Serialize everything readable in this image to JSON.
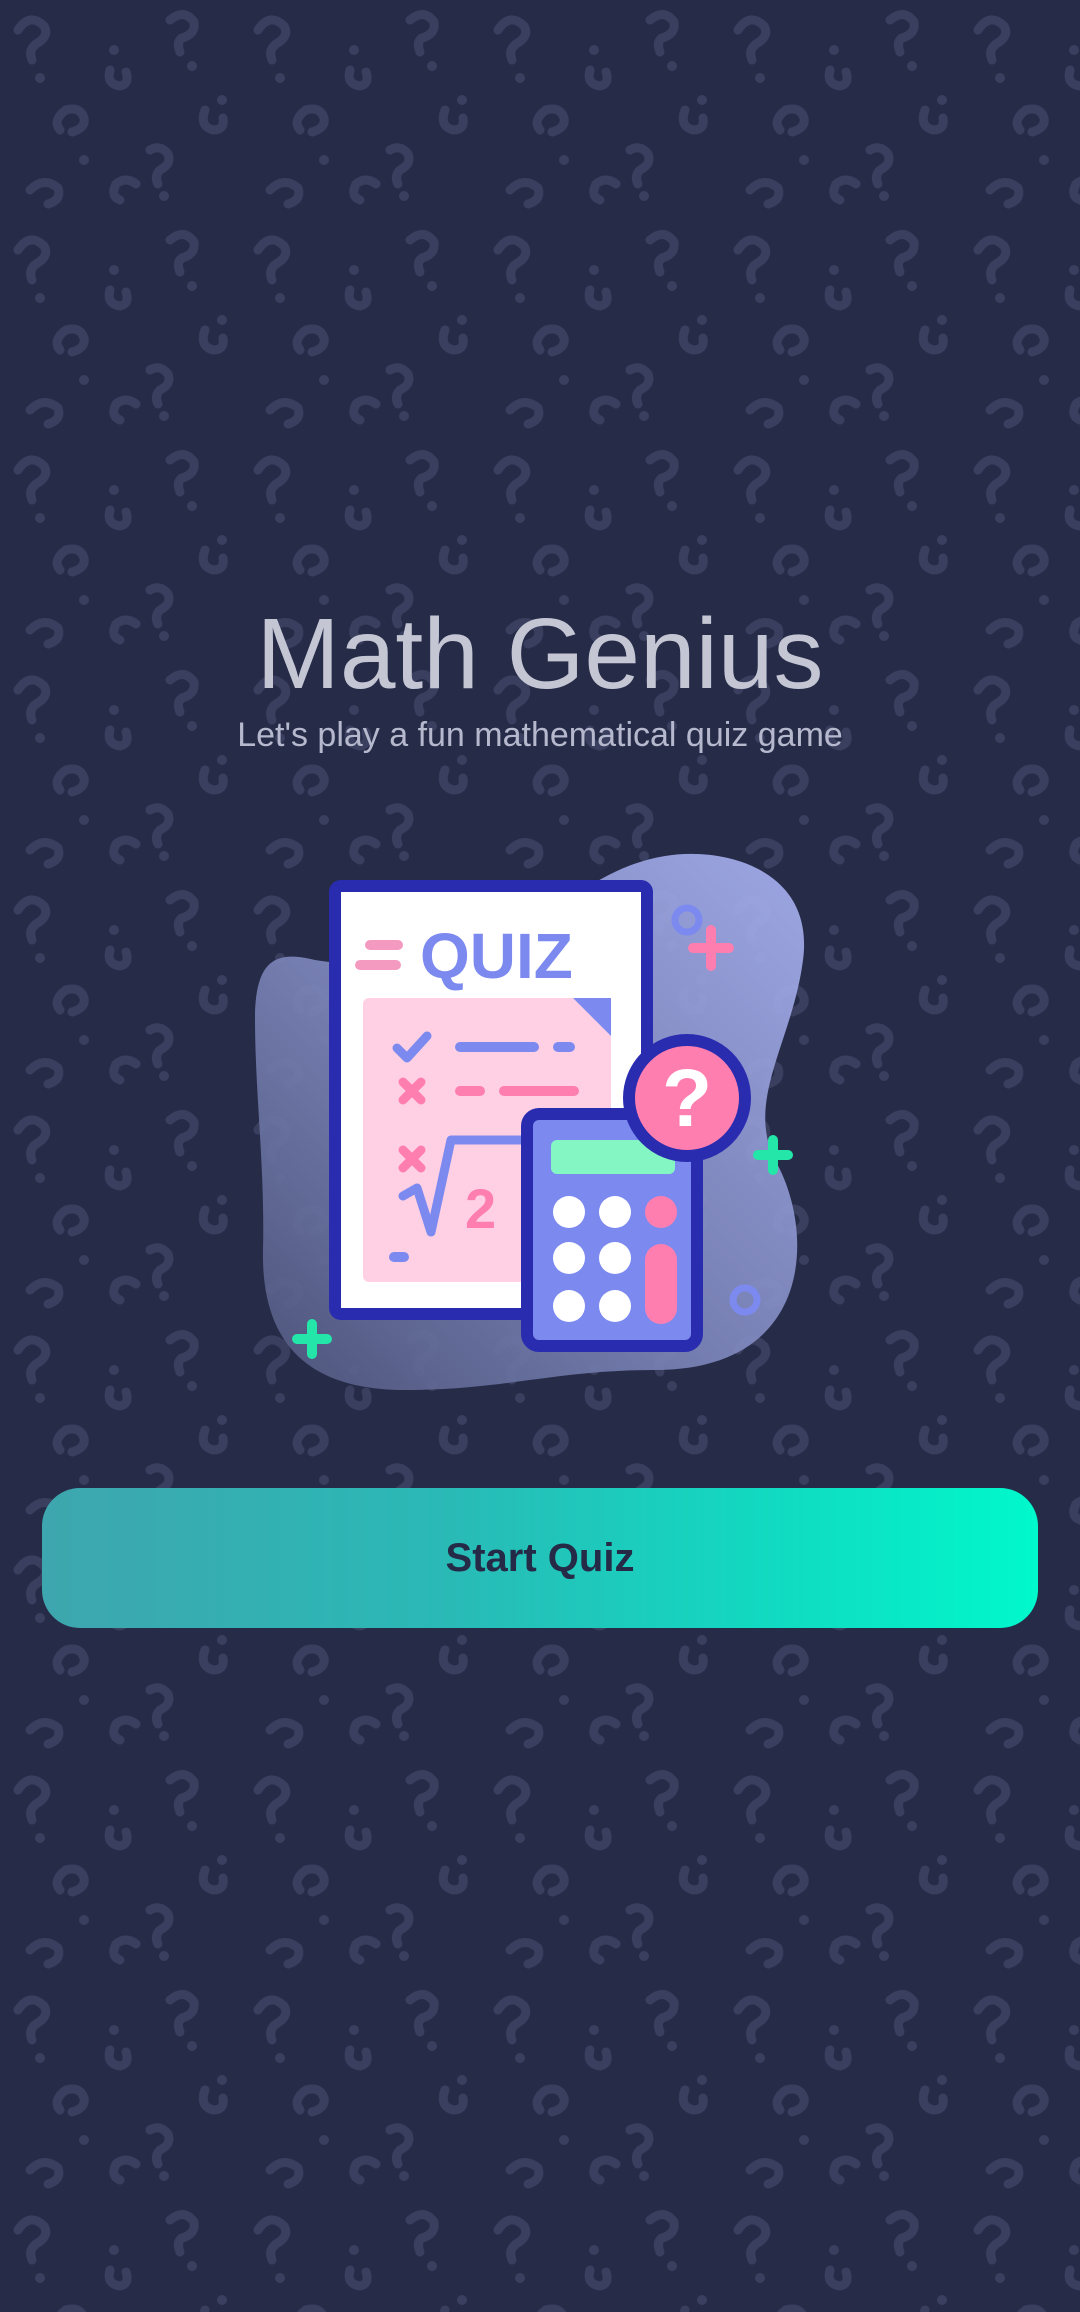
{
  "app": {
    "title": "Math Genius",
    "subtitle": "Let's play a fun mathematical quiz game"
  },
  "illustration": {
    "sheet_heading": "QUIZ",
    "formula_digit": "2",
    "badge_symbol": "?"
  },
  "actions": {
    "start_label": "Start Quiz"
  },
  "colors": {
    "background": "#262b48",
    "title_text": "#c4c6d4",
    "accent_teal": "#00f8cc",
    "accent_pink": "#ff7eb0",
    "accent_purple": "#7c8af0"
  }
}
